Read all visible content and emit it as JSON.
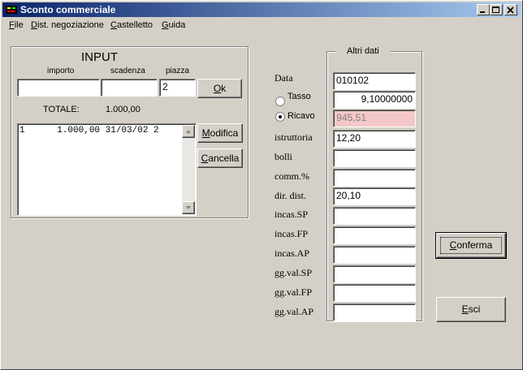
{
  "window": {
    "title": "Sconto commerciale"
  },
  "menu": [
    {
      "label": "File",
      "mnemonic": "F",
      "rest": "ile"
    },
    {
      "label": "Dist. negoziazione",
      "mnemonic": "D",
      "rest": "ist. negoziazione"
    },
    {
      "label": "Castelletto",
      "mnemonic": "C",
      "rest": "astelletto"
    },
    {
      "label": "Guida",
      "mnemonic": "G",
      "rest": "uida"
    }
  ],
  "input": {
    "title": "INPUT",
    "col_importo": "importo",
    "col_scadenza": "scadenza",
    "col_piazza": "piazza",
    "importo_value": "",
    "scadenza_value": "",
    "piazza_value": "2",
    "ok_mnemonic": "O",
    "ok_rest": "k",
    "totale_label": "TOTALE:",
    "totale_value": "1.000,00",
    "list": [
      "1      1.000,00 31/03/02 2"
    ],
    "modifica_mnemonic": "M",
    "modifica_rest": "odifica",
    "cancella_mnemonic": "C",
    "cancella_rest": "ancella"
  },
  "altri": {
    "title": "Altri dati",
    "rows": [
      {
        "label": "Data",
        "value": "010102"
      },
      {
        "label": "Tasso",
        "value": "9,10000000"
      },
      {
        "label": "Ricavo",
        "value": "945,51"
      },
      {
        "label": "istruttoria",
        "value": "12,20"
      },
      {
        "label": "bolli",
        "value": ""
      },
      {
        "label": "comm.%",
        "value": ""
      },
      {
        "label": "dir. dist.",
        "value": "20,10"
      },
      {
        "label": "incas.SP",
        "value": ""
      },
      {
        "label": "incas.FP",
        "value": ""
      },
      {
        "label": "incas.AP",
        "value": ""
      },
      {
        "label": "gg.val.SP",
        "value": ""
      },
      {
        "label": "gg.val.FP",
        "value": ""
      },
      {
        "label": "gg.val.AP",
        "value": ""
      }
    ],
    "selected_radio": "Ricavo",
    "ricavo_bg": "#f4c8c8"
  },
  "buttons": {
    "conferma_mnemonic": "C",
    "conferma_rest": "onferma",
    "esci_mnemonic": "E",
    "esci_rest": "sci"
  }
}
